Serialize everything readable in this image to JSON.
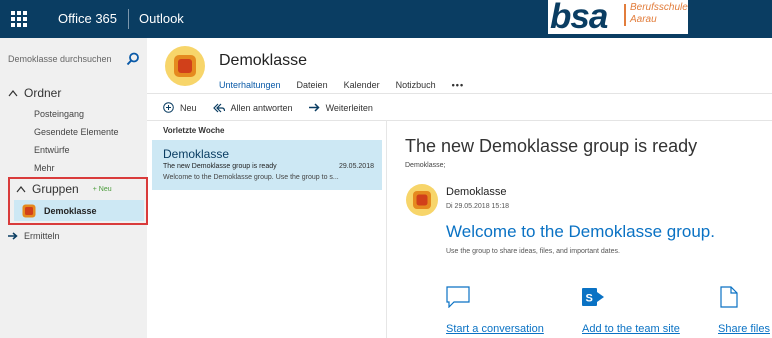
{
  "topbar": {
    "app_suite": "Office 365",
    "app_name": "Outlook",
    "logo_text": "bsa",
    "logo_line1": "Berufsschule",
    "logo_line2": "Aarau",
    "bar_color": "#0a3d62",
    "logo_accent": "#e27d3c"
  },
  "leftnav": {
    "search_placeholder": "Demoklasse durchsuchen",
    "folders_heading": "Ordner",
    "folders": [
      "Posteingang",
      "Gesendete Elemente",
      "Entwürfe",
      "Mehr"
    ],
    "groups_heading": "Gruppen",
    "new_badge": "Neu",
    "group_name": "Demoklasse",
    "discover": "Ermitteln"
  },
  "group_header": {
    "title": "Demoklasse",
    "tabs": [
      "Unterhaltungen",
      "Dateien",
      "Kalender",
      "Notizbuch"
    ],
    "more": "•••"
  },
  "commands": {
    "new": "Neu",
    "reply_all": "Allen antworten",
    "forward": "Weiterleiten"
  },
  "message_list": {
    "section": "Vorletzte Woche",
    "item": {
      "from": "Demoklasse",
      "subject": "The new Demoklasse group is ready",
      "date": "29.05.2018",
      "preview": "Welcome to the Demoklasse group. Use the group to s..."
    }
  },
  "reading_pane": {
    "title": "The new Demoklasse group is ready",
    "to": "Demoklasse;",
    "sender": "Demoklasse",
    "date": "Di 29.05.2018 15:18",
    "welcome": "Welcome to the Demoklasse group.",
    "subtitle": "Use the group to share ideas, files, and important dates.",
    "actions": [
      {
        "label": "Start a conversation",
        "icon": "chat-bubble-icon"
      },
      {
        "label": "Add to the team site",
        "icon": "sharepoint-icon"
      },
      {
        "label": "Share files",
        "icon": "document-icon"
      }
    ],
    "accent": "#0a72c4"
  }
}
